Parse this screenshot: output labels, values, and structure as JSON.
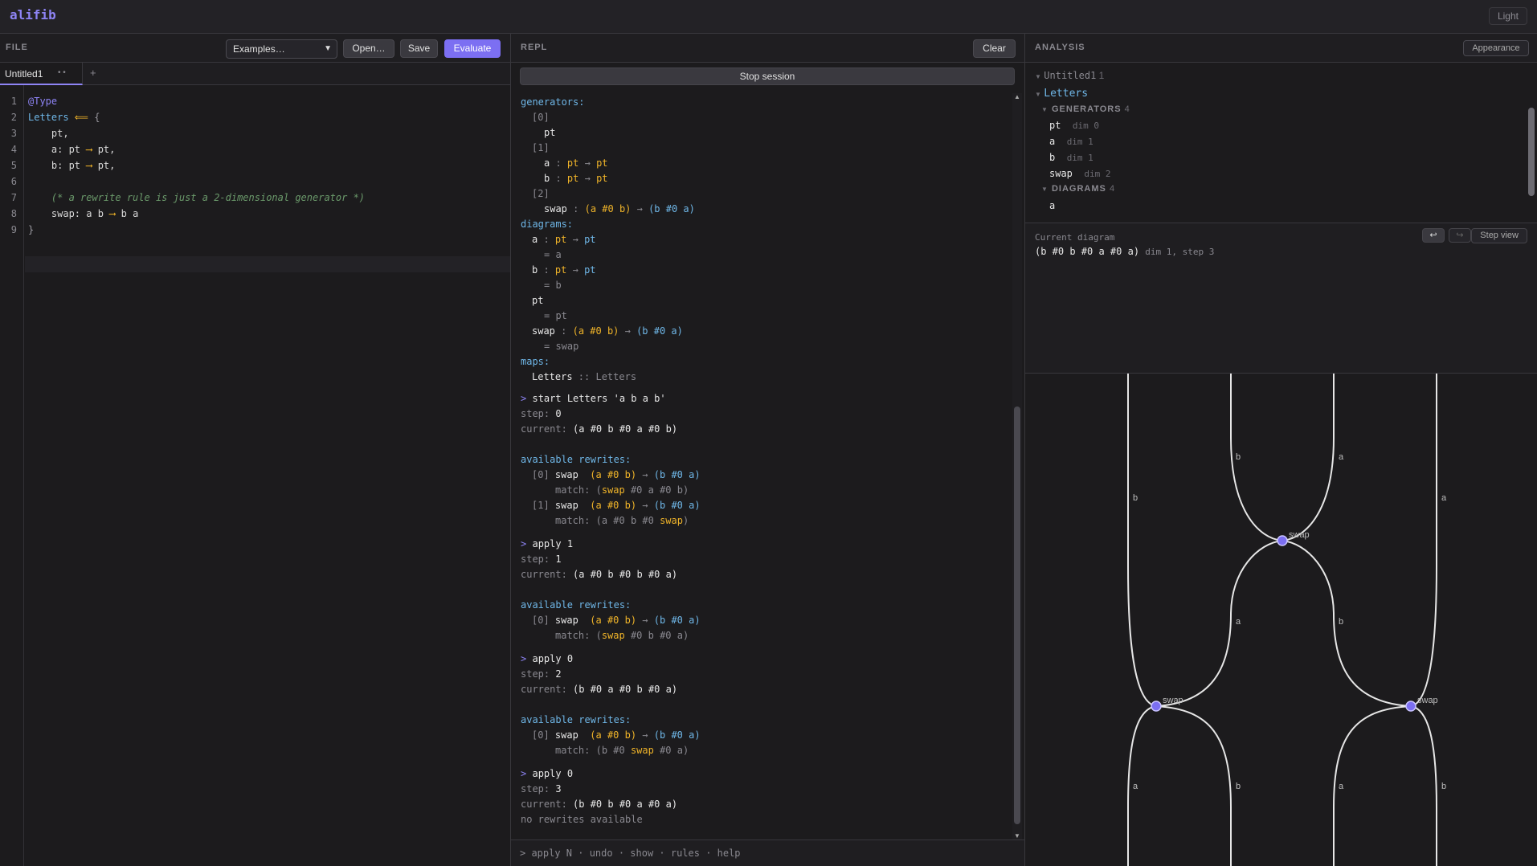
{
  "app": {
    "name": "alifib",
    "theme_label": "Light"
  },
  "file": {
    "title": "FILE",
    "examples_placeholder": "Examples…",
    "open_label": "Open…",
    "save_label": "Save",
    "evaluate_label": "Evaluate",
    "tab_label": "Untitled1",
    "tab_status": "• •",
    "tab_add": "+",
    "line_numbers": [
      "1",
      "2",
      "3",
      "4",
      "5",
      "6",
      "7",
      "8",
      "9"
    ]
  },
  "editor": {
    "l1": "@Type",
    "l2_name": "Letters",
    "l2_arrow": " ⟸ ",
    "l2_brace": "{",
    "l3": "    pt,",
    "l4_a": "    a: pt ",
    "l4_arrow": "⟶",
    "l4_b": " pt,",
    "l5_a": "    b: pt ",
    "l5_arrow": "⟶",
    "l5_b": " pt,",
    "l7": "    (* a rewrite rule is just a 2-dimensional generator *)",
    "l8_a": "    swap: a b ",
    "l8_arrow": "⟶",
    "l8_b": " b a",
    "l9": "}"
  },
  "repl": {
    "title": "REPL",
    "clear_label": "Clear",
    "stop_label": "Stop session",
    "input_hint": "> apply N · undo · show · rules · help",
    "generators_label": "generators:",
    "g0": "[0]",
    "g0_pt": "pt",
    "g1": "[1]",
    "g1_a": "a",
    "g1_b": "b",
    "colon": " : ",
    "pt": "pt",
    "to": " → ",
    "g2": "[2]",
    "g2_swap": "swap",
    "src_swap": "(a #0 b)",
    "tgt_swap": "(b #0 a)",
    "diagrams_label": "diagrams:",
    "eq_a": "= a",
    "eq_b": "= b",
    "eq_pt": "= pt",
    "eq_swap": "= swap",
    "maps_label": "maps:",
    "maps_letters": "Letters",
    "maps_sep": " :: ",
    "maps_target": "Letters",
    "cmd_start": "start Letters 'a b a b'",
    "prompt": ">",
    "step_label": "step:",
    "current_label": "current:",
    "step0": "0",
    "cur0": "(a #0 b #0 a #0 b)",
    "avail_label": "available rewrites:",
    "idx0": "[0]",
    "idx1": "[1]",
    "match_label": "match:",
    "m0_open": "(",
    "m0_swap": "swap",
    "m0_rest": " #0 a #0 b)",
    "m1_a": "(a #0 b #0 ",
    "m1_swap": "swap",
    "m1_close": ")",
    "cmd_apply1": "apply 1",
    "step1": "1",
    "cur1": "(a #0 b #0 b #0 a)",
    "m2_rest": " #0 b #0 a)",
    "cmd_apply0": "apply 0",
    "step2": "2",
    "cur2": "(b #0 a #0 b #0 a)",
    "m3_a": "(b #0 ",
    "m3_rest": " #0 a)",
    "step3": "3",
    "cur3": "(b #0 b #0 a #0 a)",
    "no_rewrites": "no rewrites available"
  },
  "analysis": {
    "title": "ANALYSIS",
    "appearance_label": "Appearance",
    "tree_untitled": "Untitled1",
    "tree_untitled_count": "1",
    "tree_letters": "Letters",
    "generators_label": "GENERATORS",
    "generators_count": "4",
    "gen_pt": "pt",
    "gen_pt_dim": "dim 0",
    "gen_a": "a",
    "gen_a_dim": "dim 1",
    "gen_b": "b",
    "gen_b_dim": "dim 1",
    "gen_swap": "swap",
    "gen_swap_dim": "dim 2",
    "diagrams_label": "DIAGRAMS",
    "diagrams_count": "4",
    "diag_a": "a",
    "current_label": "Current diagram",
    "current_expr": "(b #0 b #0 a #0 a)",
    "current_meta": "dim 1, step 3",
    "undo_icon": "undo-icon",
    "redo_icon": "redo-icon",
    "stepview_label": "Step view"
  },
  "diagram": {
    "wire_labels": {
      "b": "b",
      "a": "a"
    },
    "node_label": "swap",
    "colors": {
      "wire": "#e6e6e6",
      "node": "#7c6ff2",
      "label": "#bdbdbd"
    }
  }
}
